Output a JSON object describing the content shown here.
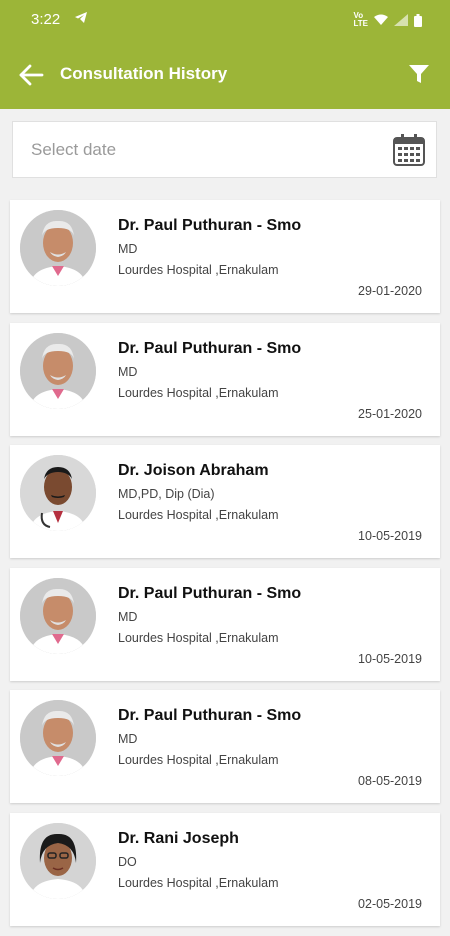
{
  "status_bar": {
    "time": "3:22"
  },
  "header": {
    "title": "Consultation History"
  },
  "date_filter": {
    "placeholder": "Select date"
  },
  "consultations": [
    {
      "name": "Dr. Paul Puthuran - Smo",
      "degree": "MD",
      "hospital": "Lourdes Hospital ,Ernakulam",
      "date": "29-01-2020",
      "avatar": "male-doctor-1"
    },
    {
      "name": "Dr. Paul Puthuran - Smo",
      "degree": "MD",
      "hospital": "Lourdes Hospital ,Ernakulam",
      "date": "25-01-2020",
      "avatar": "male-doctor-1"
    },
    {
      "name": "Dr. Joison Abraham",
      "degree": "MD,PD, Dip (Dia)",
      "hospital": "Lourdes Hospital ,Ernakulam",
      "date": "10-05-2019",
      "avatar": "male-doctor-2"
    },
    {
      "name": "Dr. Paul Puthuran - Smo",
      "degree": "MD",
      "hospital": "Lourdes Hospital ,Ernakulam",
      "date": "10-05-2019",
      "avatar": "male-doctor-1"
    },
    {
      "name": "Dr. Paul Puthuran - Smo",
      "degree": "MD",
      "hospital": "Lourdes Hospital ,Ernakulam",
      "date": "08-05-2019",
      "avatar": "male-doctor-1"
    },
    {
      "name": "Dr. Rani Joseph",
      "degree": "DO",
      "hospital": "Lourdes Hospital ,Ernakulam",
      "date": "02-05-2019",
      "avatar": "female-doctor"
    }
  ],
  "colors": {
    "appbar": "#9cb538",
    "background": "#f1f1f1"
  }
}
